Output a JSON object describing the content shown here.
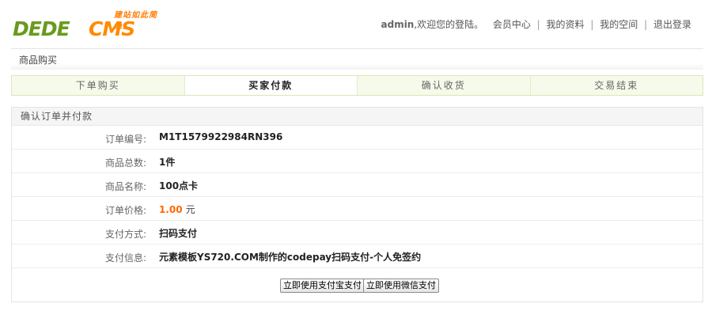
{
  "header": {
    "logo_tagline": "建站如此简单!",
    "logo_dede": "DEDE",
    "logo_cms": "CMS",
    "username": "admin",
    "welcome": ",欢迎您的登陆。",
    "links": [
      "会员中心",
      "我的资料",
      "我的空间",
      "退出登录"
    ]
  },
  "page": {
    "title": "商品购买"
  },
  "steps": [
    {
      "label": "下单购买",
      "active": false
    },
    {
      "label": "买家付款",
      "active": true
    },
    {
      "label": "确认收货",
      "active": false
    },
    {
      "label": "交易结束",
      "active": false
    }
  ],
  "order": {
    "title": "确认订单并付款",
    "rows": [
      {
        "label": "订单编号:",
        "value": "M1T1579922984RN396"
      },
      {
        "label": "商品总数:",
        "value": "1件"
      },
      {
        "label": "商品名称:",
        "value": "100点卡"
      },
      {
        "label": "订单价格:",
        "price": "1.00",
        "unit": "元"
      },
      {
        "label": "支付方式:",
        "value": "扫码支付"
      },
      {
        "label": "支付信息:",
        "value": "元素模板YS720.COM制作的codepay扫码支付-个人免签约"
      }
    ],
    "buttons": {
      "alipay": "立即使用支付宝支付",
      "wechat": "立即使用微信支付"
    }
  },
  "colors": {
    "price": "#ff6600",
    "logo_green": "#6a9a1e",
    "logo_orange": "#ff8a00"
  }
}
